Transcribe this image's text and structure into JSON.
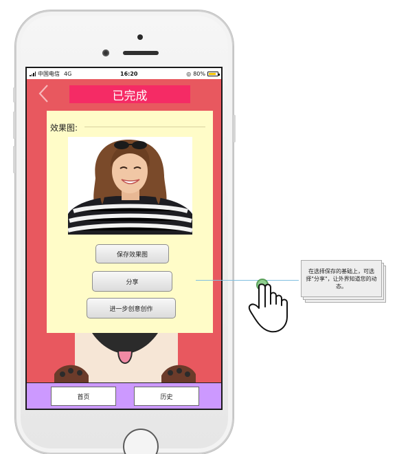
{
  "statusbar": {
    "carrier": "中国电信",
    "network": "4G",
    "time": "16:20",
    "battery": "80%",
    "battery_level": 0.8
  },
  "header": {
    "back_icon": "chevron-left-icon",
    "title": "已完成"
  },
  "result": {
    "label": "效果图:"
  },
  "actions": {
    "save_label": "保存效果图",
    "share_label": "分享",
    "create_label": "进一步创意创作"
  },
  "tabs": {
    "home_label": "首页",
    "history_label": "历史"
  },
  "annotation": {
    "note": "在选择保存的基础上，可选择\"分享\"，让外界知道您的动态。"
  },
  "colors": {
    "screen_bg": "#e8585f",
    "title_bg": "#f52b65",
    "content_bg": "#fffcc8",
    "tabbar_bg": "#cc99ff"
  }
}
